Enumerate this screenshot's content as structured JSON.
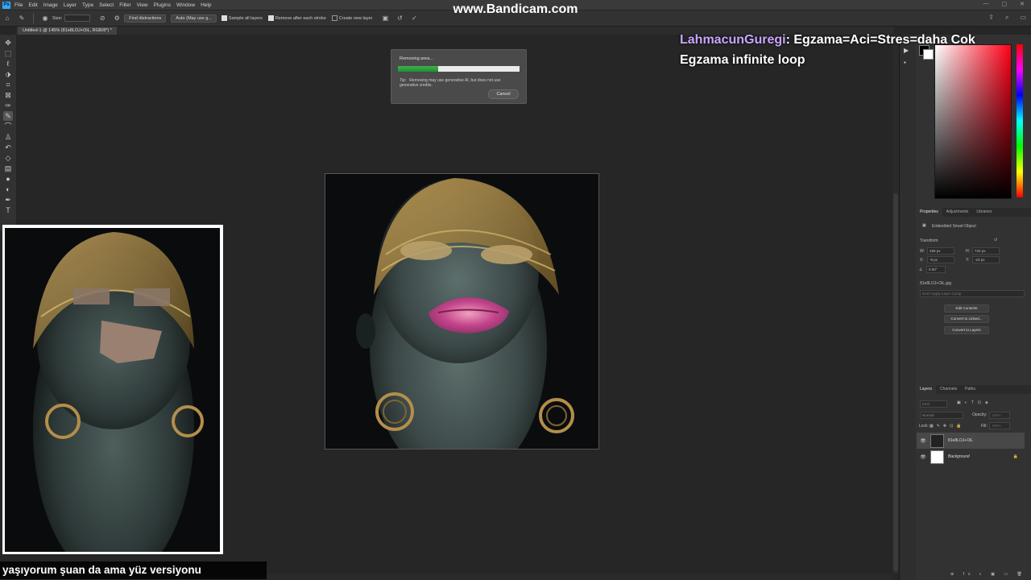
{
  "app": {
    "menu": [
      "File",
      "Edit",
      "Image",
      "Layer",
      "Type",
      "Select",
      "Filter",
      "View",
      "Plugins",
      "Window",
      "Help"
    ],
    "watermark": "www.Bandicam.com"
  },
  "options_bar": {
    "size_label": "Size:",
    "find_distractions": "Find distractions",
    "mode_select": "Auto (May use g...",
    "sample_all_layers": "Sample all layers",
    "remove_after_stroke": "Remove after each stroke",
    "create_new_layer": "Create new layer"
  },
  "document": {
    "tab_title": "Untitled-1 @ 145% (81e8LOJ+OiL, RGB/8*) *"
  },
  "dialog": {
    "title": "Removing area...",
    "progress": 0.33,
    "tip_label": "Tip:",
    "tip_text": "Removing may use generative AI, but does not use generative credits.",
    "cancel": "Cancel"
  },
  "properties": {
    "tabs": [
      "Properties",
      "Adjustments",
      "Libraries"
    ],
    "object_type": "Embedded Smart Object",
    "transform_label": "Transform",
    "w_label": "W:",
    "w_value": "485 px",
    "h_label": "H:",
    "h_value": "720 px",
    "x_label": "X:",
    "x_value": "-9 px",
    "y_label": "Y:",
    "y_value": "-23 px",
    "angle_value": "0.00°",
    "filename": "81e8LOJ+OiL.jpg",
    "layer_comp_placeholder": "Don't Apply Layer Comp",
    "buttons": [
      "Edit Contents",
      "Convert to Linked...",
      "Convert to Layers"
    ]
  },
  "layers": {
    "tabs": [
      "Layers",
      "Channels",
      "Paths"
    ],
    "kind_placeholder": "Kind",
    "blend_mode": "Normal",
    "opacity_label": "Opacity:",
    "opacity_value": "100%",
    "lock_label": "Lock:",
    "fill_label": "Fill:",
    "fill_value": "100%",
    "items": [
      {
        "name": "81e8LOJ+OiL",
        "selected": true
      },
      {
        "name": "Background",
        "selected": false
      }
    ]
  },
  "chat": {
    "user": "LahmacunGuregi",
    "separator": ":",
    "message": "Egzama=Aci=Stres=daha Cok Egzama infinite loop"
  },
  "subtitle": "yaşıyorum şuan da ama yüz versiyonu",
  "colors": {
    "fg": "#000000",
    "bg": "#ffffff",
    "progress": "#2fa53e",
    "chat_user": "#c9a5ff"
  }
}
